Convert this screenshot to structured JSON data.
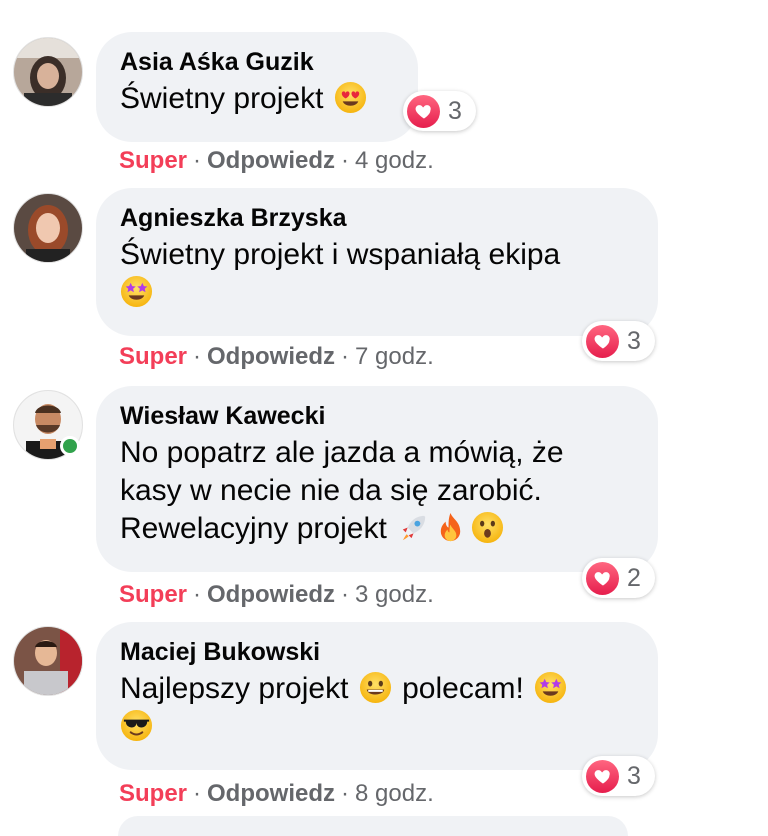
{
  "comments": [
    {
      "name": "Asia Aśka Guzik",
      "text": "Świetny projekt",
      "emojis": [
        "heart-eyes-emoji"
      ],
      "reaction_count": "3",
      "actions": {
        "like": "Super",
        "reply": "Odpowiedz",
        "time": "4 godz."
      },
      "online": false
    },
    {
      "name": "Agnieszka Brzyska",
      "text": "Świetny projekt i wspaniałą ekipa",
      "emojis": [
        "star-struck-emoji"
      ],
      "reaction_count": "3",
      "actions": {
        "like": "Super",
        "reply": "Odpowiedz",
        "time": "7 godz."
      },
      "online": false
    },
    {
      "name": "Wiesław Kawecki",
      "text_lines": [
        "No popatrz ale jazda a mówią, że",
        "kasy w necie nie da się zarobić.",
        "Rewelacyjny projekt"
      ],
      "emojis": [
        "rocket-emoji",
        "fire-emoji",
        "astonished-emoji"
      ],
      "reaction_count": "2",
      "actions": {
        "like": "Super",
        "reply": "Odpowiedz",
        "time": "3 godz."
      },
      "online": true
    },
    {
      "name": "Maciej Bukowski",
      "text_a": "Najlepszy projekt",
      "text_b": "polecam!",
      "emojis": [
        "grinning-emoji",
        "star-struck-emoji",
        "sunglasses-emoji"
      ],
      "reaction_count": "3",
      "actions": {
        "like": "Super",
        "reply": "Odpowiedz",
        "time": "8 godz."
      },
      "online": false
    }
  ],
  "separator": "·",
  "colors": {
    "bubble_bg": "#f0f2f5",
    "super_red": "#f33e58",
    "meta_gray": "#65676b",
    "online_green": "#31a24c",
    "heart_pink": "#f33e58"
  }
}
